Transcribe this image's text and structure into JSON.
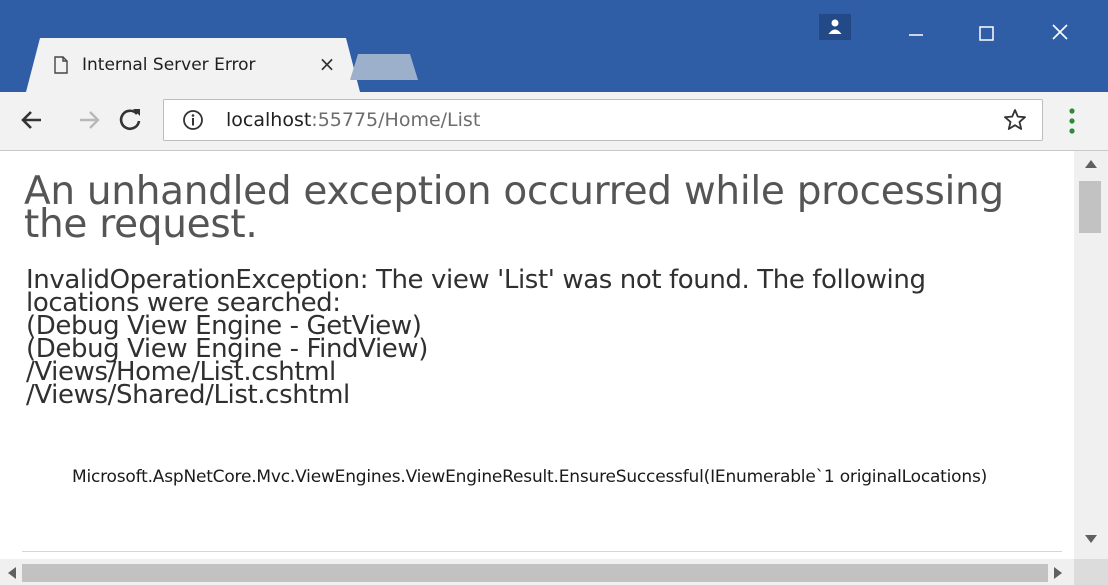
{
  "tab": {
    "title": "Internal Server Error",
    "close_glyph": "×"
  },
  "toolbar": {
    "url_host": "localhost",
    "url_path": ":55775/Home/List"
  },
  "page": {
    "heading": "An unhandled exception occurred while processing the request.",
    "error_lines": [
      "InvalidOperationException: The view 'List' was not found. The following",
      "locations were searched:",
      "(Debug View Engine - GetView)",
      "(Debug View Engine - FindView)",
      "/Views/Home/List.cshtml",
      "/Views/Shared/List.cshtml"
    ],
    "stack_frame": "Microsoft.AspNetCore.Mvc.ViewEngines.ViewEngineResult.EnsureSuccessful(IEnumerable`1 originalLocations)"
  },
  "icons": {
    "tab": "document-icon",
    "back": "back-arrow-icon",
    "forward": "forward-arrow-icon",
    "reload": "reload-icon",
    "info": "info-icon",
    "bookmark": "star-icon",
    "menu": "kebab-menu-icon",
    "user": "user-icon",
    "minimize": "minimize-icon",
    "maximize": "maximize-icon",
    "close": "close-icon"
  },
  "colors": {
    "titlebar": "#2f5ea6",
    "toolbar": "#f2f2f2",
    "menu_dots": "#2e8b3a",
    "heading": "#555555"
  }
}
